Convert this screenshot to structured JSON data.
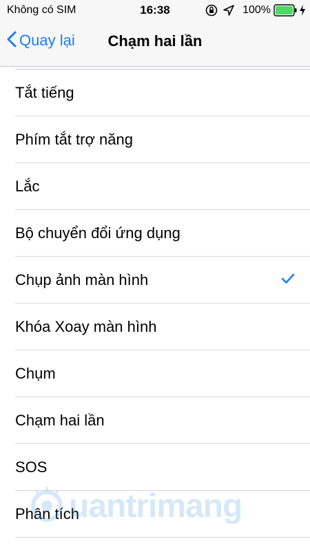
{
  "status_bar": {
    "carrier": "Không có SIM",
    "time": "16:38",
    "battery_percent": "100%",
    "battery_level": 1.0,
    "icons": [
      "orientation-lock-icon",
      "location-icon",
      "battery-icon",
      "charging-icon"
    ]
  },
  "nav": {
    "back_label": "Quay lại",
    "title": "Chạm hai lần"
  },
  "rows": [
    {
      "label": "Tắt tiếng",
      "checked": false
    },
    {
      "label": "Phím tắt trợ năng",
      "checked": false
    },
    {
      "label": "Lắc",
      "checked": false
    },
    {
      "label": "Bộ chuyển đổi ứng dụng",
      "checked": false
    },
    {
      "label": "Chụp ảnh màn hình",
      "checked": true
    },
    {
      "label": "Khóa Xoay màn hình",
      "checked": false
    },
    {
      "label": "Chụm",
      "checked": false
    },
    {
      "label": "Chạm hai lần",
      "checked": false
    },
    {
      "label": "SOS",
      "checked": false
    },
    {
      "label": "Phân tích",
      "checked": false
    }
  ],
  "watermark": {
    "text": "uantrimang"
  },
  "colors": {
    "accent": "#1a7cf7",
    "separator": "#d7d7db",
    "bar_background": "#f7f7f7",
    "battery_fill": "#4cd964"
  }
}
